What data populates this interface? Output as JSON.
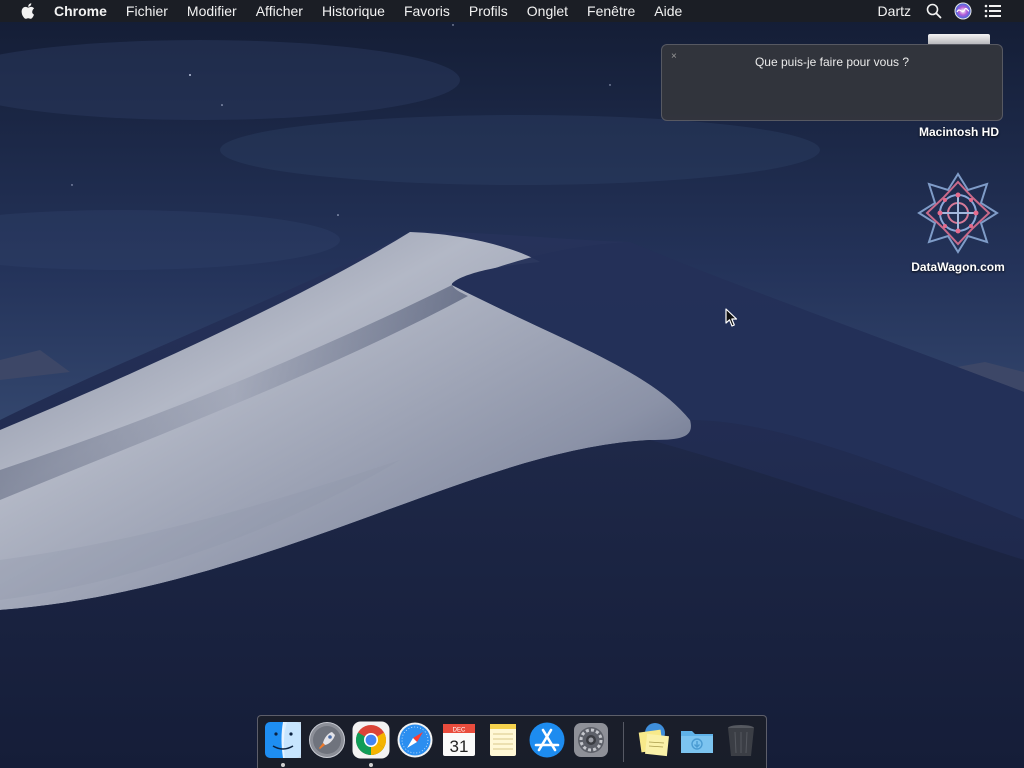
{
  "menubar": {
    "apple_icon": "apple-logo",
    "app_name": "Chrome",
    "items": [
      "Fichier",
      "Modifier",
      "Afficher",
      "Historique",
      "Favoris",
      "Profils",
      "Onglet",
      "Fenêtre",
      "Aide"
    ],
    "user": "Dartz",
    "status_icons": [
      "spotlight-search-icon",
      "siri-icon",
      "notification-center-icon"
    ]
  },
  "siri_panel": {
    "close_glyph": "×",
    "prompt": "Que puis-je faire pour vous ?"
  },
  "desktop_icons": [
    {
      "label": "Macintosh HD",
      "icon": "hard-drive-icon"
    },
    {
      "label": "DataWagon.com",
      "icon": "datawagon-icon"
    }
  ],
  "dock": {
    "apps": [
      {
        "name": "Finder",
        "icon": "finder-icon",
        "running": true
      },
      {
        "name": "Launchpad",
        "icon": "launchpad-icon",
        "running": false
      },
      {
        "name": "Google Chrome",
        "icon": "chrome-icon",
        "running": true
      },
      {
        "name": "Safari",
        "icon": "safari-icon",
        "running": false
      },
      {
        "name": "Calendar",
        "icon": "calendar-icon",
        "running": false,
        "month": "DEC",
        "day": "31"
      },
      {
        "name": "Notes",
        "icon": "notes-icon",
        "running": false
      },
      {
        "name": "App Store",
        "icon": "app-store-icon",
        "running": false
      },
      {
        "name": "System Preferences",
        "icon": "system-preferences-icon",
        "running": false
      }
    ],
    "others": [
      {
        "name": "Stickies Stack",
        "icon": "stickies-icon"
      },
      {
        "name": "Downloads",
        "icon": "downloads-folder-icon"
      },
      {
        "name": "Trash",
        "icon": "trash-icon"
      }
    ]
  },
  "colors": {
    "sky_top": "#15203a",
    "sky_mid": "#2a3b5e",
    "dune_light": "#a7adbc",
    "dune_shadow": "#1d2747",
    "menubar_bg": "#1c1e24",
    "siri_panel_bg": "#34363c",
    "dock_bg": "#1c1e24"
  }
}
